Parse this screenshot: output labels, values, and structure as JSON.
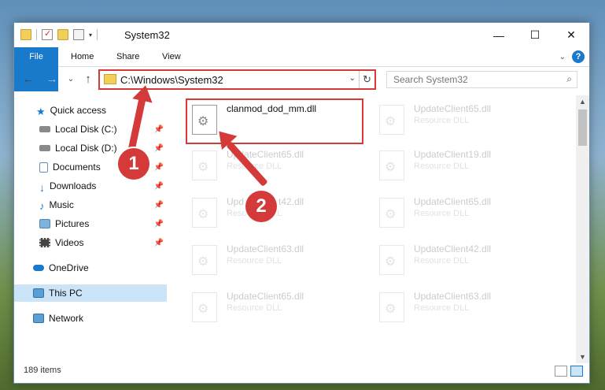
{
  "window": {
    "title": "System32",
    "buttons": {
      "minimize": "—",
      "maximize": "☐",
      "close": "✕"
    }
  },
  "ribbon": {
    "tabs": [
      "File",
      "Home",
      "Share",
      "View"
    ],
    "expand": "⌄",
    "help": "?"
  },
  "address": {
    "path": "C:\\Windows\\System32",
    "dropdown": "⌄",
    "refresh": "↻"
  },
  "search": {
    "placeholder": "Search System32",
    "icon": "⌕"
  },
  "nav": {
    "back": "←",
    "forward": "→",
    "recent": "⌄",
    "up": "↑",
    "items": [
      {
        "label": "Quick access",
        "icon": "star-icon"
      },
      {
        "label": "Local Disk (C:)",
        "icon": "drive-icon",
        "pinned": true
      },
      {
        "label": "Local Disk (D:)",
        "icon": "drive-icon",
        "pinned": true
      },
      {
        "label": "Documents",
        "icon": "documents-icon",
        "pinned": true
      },
      {
        "label": "Downloads",
        "icon": "download-icon",
        "pinned": true
      },
      {
        "label": "Music",
        "icon": "music-icon",
        "pinned": true
      },
      {
        "label": "Pictures",
        "icon": "pictures-icon",
        "pinned": true
      },
      {
        "label": "Videos",
        "icon": "videos-icon",
        "pinned": true
      },
      {
        "label": "OneDrive",
        "icon": "cloud-icon"
      },
      {
        "label": "This PC",
        "icon": "computer-icon",
        "selected": true
      },
      {
        "label": "Network",
        "icon": "network-icon"
      }
    ],
    "pin_glyph": "📌"
  },
  "files": {
    "highlighted": {
      "name": "clanmod_dod_mm.dll",
      "type": ""
    },
    "left_column": [
      {
        "name": "UpdateClient65.dll",
        "type": "Resource DLL"
      },
      {
        "name": "UpdateClient42.dll",
        "type": "Resource DLL"
      },
      {
        "name": "UpdateClient63.dll",
        "type": "Resource DLL"
      },
      {
        "name": "UpdateClient65.dll",
        "type": "Resource DLL"
      }
    ],
    "right_column": [
      {
        "name": "UpdateClient65.dll",
        "type": "Resource DLL"
      },
      {
        "name": "UpdateClient19.dll",
        "type": "Resource DLL"
      },
      {
        "name": "UpdateClient65.dll",
        "type": "Resource DLL"
      },
      {
        "name": "UpdateClient42.dll",
        "type": "Resource DLL"
      },
      {
        "name": "UpdateClient63.dll",
        "type": "Resource DLL"
      }
    ]
  },
  "status": {
    "item_count": "189 items"
  },
  "annotations": {
    "step1": "1",
    "step2": "2",
    "color": "#d43a3a"
  }
}
